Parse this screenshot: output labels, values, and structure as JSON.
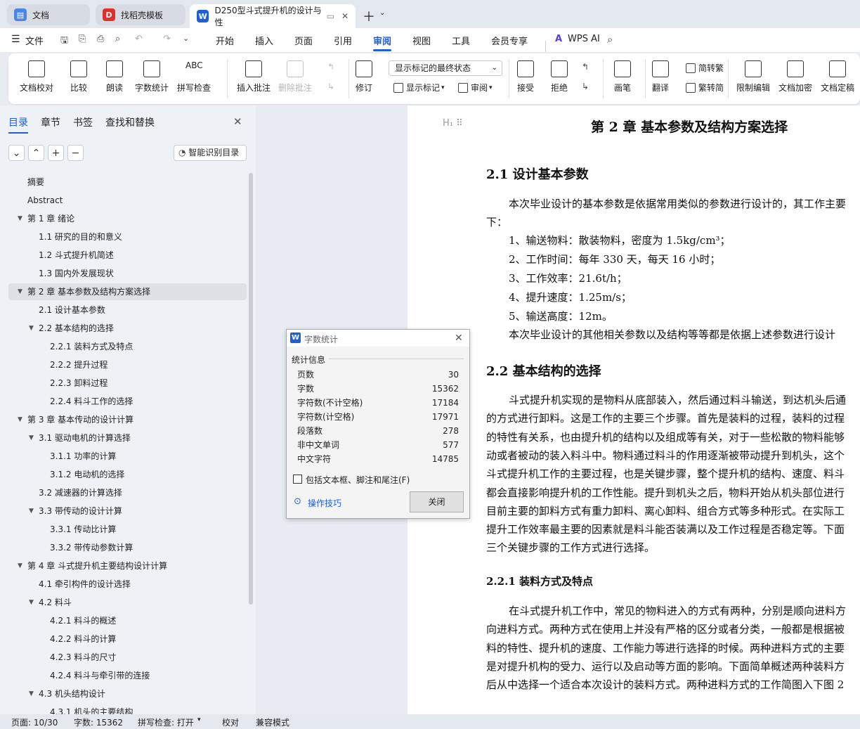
{
  "tabs": [
    {
      "label": "文档"
    },
    {
      "label": "找稻壳模板"
    },
    {
      "label": "D250型斗式提升机的设计与性"
    }
  ],
  "menu": {
    "file": "文件",
    "items": [
      "开始",
      "插入",
      "页面",
      "引用",
      "审阅",
      "视图",
      "工具",
      "会员专享"
    ],
    "ai": "WPS AI"
  },
  "ribbon": {
    "check": "文档校对",
    "compare": "比较",
    "read": "朗读",
    "wordcount": "字数统计",
    "spell": "拼写检查",
    "insert_comment": "插入批注",
    "delete_comment": "删除批注",
    "revise": "修订",
    "markup_state": "显示标记的最终状态",
    "show_markup": "显示标记",
    "review": "审阅",
    "accept": "接受",
    "reject": "拒绝",
    "ink": "画笔",
    "translate": "翻译",
    "to_trad": "简转繁",
    "to_simp": "繁转简",
    "restrict": "限制编辑",
    "encrypt": "文档加密",
    "finalize": "文档定稿"
  },
  "panel": {
    "tabs": [
      "目录",
      "章节",
      "书签",
      "查找和替换"
    ],
    "smart": "智能识别目录",
    "toc": [
      "摘要",
      "Abstract",
      "第 1 章  绪论",
      "1.1 研究的目的和意义",
      "1.2 斗式提升机简述",
      "1.3 国内外发展现状",
      "第 2 章  基本参数及结构方案选择",
      "2.1 设计基本参数",
      "2.2 基本结构的选择",
      "2.2.1 装料方式及特点",
      "2.2.2 提升过程",
      "2.2.3 卸料过程",
      "2.2.4 料斗工作的选择",
      "第 3 章  基本传动的设计计算",
      "3.1 驱动电机的计算选择",
      "3.1.1 功率的计算",
      "3.1.2 电动机的选择",
      "3.2 减速器的计算选择",
      "3.3 带传动的设计计算",
      "3.3.1 传动比计算",
      "3.3.2 带传动参数计算",
      "第 4 章  斗式提升机主要结构设计计算",
      "4.1 牵引构件的设计选择",
      "4.2 料斗",
      "4.2.1 料斗的概述",
      "4.2.2 料斗的计算",
      "4.2.3 料斗的尺寸",
      "4.2.4 料斗与牵引带的连接",
      "4.3 机头结构设计",
      "4.3.1 机头的主要结构"
    ]
  },
  "doc": {
    "chapter": "第 2 章  基本参数及结构方案选择",
    "h21": "2.1 设计基本参数",
    "p1": "本次毕业设计的基本参数是依据常用类似的参数进行设计的，其工作主要",
    "p1b": "下：",
    "list": [
      "1、输送物料：散装物料，密度为 1.5kg/cm³；",
      "2、工作时间：每年 330 天，每天 16 小时；",
      "3、工作效率：21.6t/h；",
      "4、提升速度：1.25m/s；",
      "5、输送高度：12m。"
    ],
    "p2": "本次毕业设计的其他相关参数以及结构等等都是依据上述参数进行设计",
    "h22": "2.2 基本结构的选择",
    "p3": [
      "斗式提升机实现的是物料从底部装入，然后通过料斗输送，到达机头后通",
      "的方式进行卸料。这是工作的主要三个步骤。首先是装料的过程，装料的过程",
      "的特性有关系，也由提升机的结构以及组成等有关，对于一些松散的物料能够",
      "动或者被动的装入料斗中。物料通过料斗的作用逐渐被带动提升到机头，这个",
      "斗式提升机工作的主要过程，也是关键步骤，整个提升机的结构、速度、料斗",
      "都会直接影响提升机的工作性能。提升到机头之后，物料开始从机头部位进行",
      "目前主要的卸料方式有重力卸料、离心卸料、组合方式等多种形式。在实际工",
      "提升工作效率最主要的因素就是料斗能否装满以及工作过程是否稳定等。下面",
      "三个关键步骤的工作方式进行选择。"
    ],
    "h221": "2.2.1 装料方式及特点",
    "p4": [
      "在斗式提升机工作中，常见的物料进入的方式有两种，分别是顺向进料方",
      "向进料方式。两种方式在使用上并没有严格的区分或者分类，一般都是根据被",
      "料的特性、提升机的速度、工作能力等进行选择的时候。两种进料方式的主要",
      "是对提升机构的受力、运行以及启动等方面的影响。下面简单概述两种装料方",
      "后从中选择一个适合本次设计的装料方式。两种进料方式的工作简图入下图 2"
    ]
  },
  "dialog": {
    "title": "字数统计",
    "section": "统计信息",
    "stats": [
      {
        "label": "页数",
        "value": "30"
      },
      {
        "label": "字数",
        "value": "15362"
      },
      {
        "label": "字符数(不计空格)",
        "value": "17184"
      },
      {
        "label": "字符数(计空格)",
        "value": "17971"
      },
      {
        "label": "段落数",
        "value": "278"
      },
      {
        "label": "非中文单词",
        "value": "577"
      },
      {
        "label": "中文字符",
        "value": "14785"
      }
    ],
    "include": "包括文本框、脚注和尾注(F)",
    "tips": "操作技巧",
    "close": "关闭"
  },
  "status": {
    "page": "页面: 10/30",
    "words": "字数: 15362",
    "spell": "拼写检查: 打开",
    "proof": "校对",
    "compat": "兼容模式"
  },
  "colors": {
    "accent": "#1e5fd8",
    "wps_red": "#e0302a"
  }
}
